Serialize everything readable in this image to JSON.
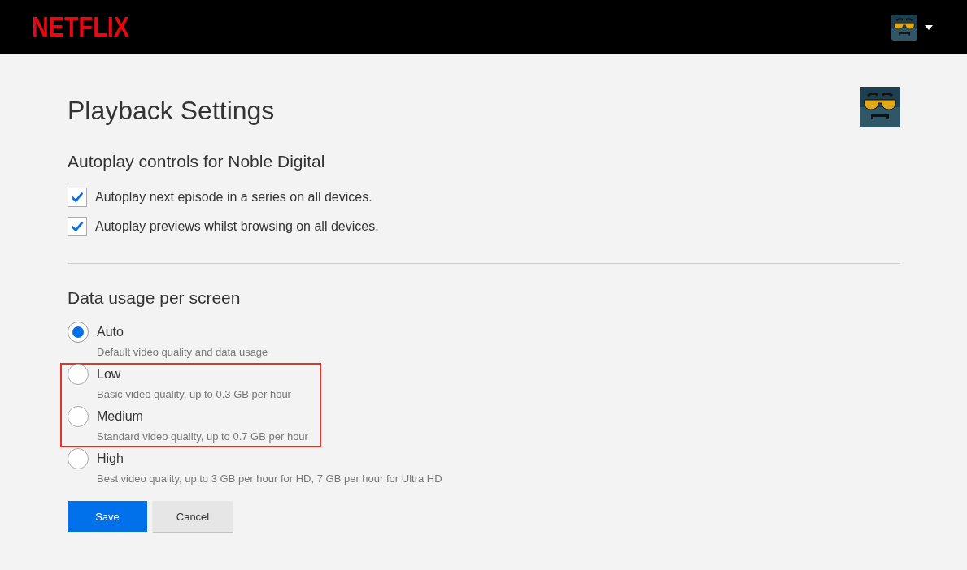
{
  "header": {
    "logo": "NETFLIX"
  },
  "title": "Playback Settings",
  "autoplay": {
    "heading": "Autoplay controls for Noble Digital",
    "options": [
      {
        "label": "Autoplay next episode in a series on all devices.",
        "checked": true
      },
      {
        "label": "Autoplay previews whilst browsing on all devices.",
        "checked": true
      }
    ]
  },
  "data_usage": {
    "heading": "Data usage per screen",
    "options": [
      {
        "label": "Auto",
        "description": "Default video quality and data usage",
        "selected": true,
        "highlighted": false
      },
      {
        "label": "Low",
        "description": "Basic video quality, up to 0.3 GB per hour",
        "selected": false,
        "highlighted": true
      },
      {
        "label": "Medium",
        "description": "Standard video quality, up to 0.7 GB per hour",
        "selected": false,
        "highlighted": true
      },
      {
        "label": "High",
        "description": "Best video quality, up to 3 GB per hour for HD, 7 GB per hour for Ultra HD",
        "selected": false,
        "highlighted": false
      }
    ]
  },
  "buttons": [
    {
      "label": "Save",
      "kind": "primary"
    },
    {
      "label": "Cancel",
      "kind": "secondary"
    }
  ]
}
